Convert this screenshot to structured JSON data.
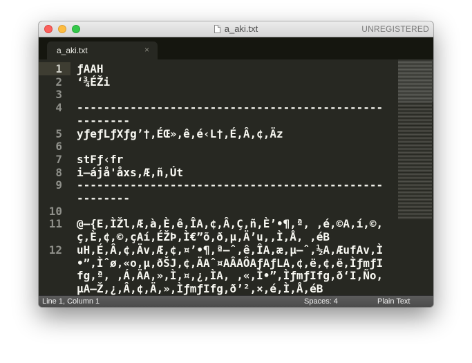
{
  "window": {
    "title": "a_aki.txt",
    "registration": "UNREGISTERED"
  },
  "tabs": [
    {
      "label": "a_aki.txt",
      "close": "×"
    }
  ],
  "editor": {
    "rows": [
      {
        "num": "1",
        "text": "ƒAAH"
      },
      {
        "num": "2",
        "text": "‘¾ÉŽi"
      },
      {
        "num": "3",
        "text": ""
      },
      {
        "num": "4",
        "text": "----------------------------------------------"
      },
      {
        "num": "",
        "text": "--------"
      },
      {
        "num": "5",
        "text": "yƒeƒLƒXƒg’†,ÉŒ»,ê,é‹L†,É,Â,¢,Äz"
      },
      {
        "num": "6",
        "text": ""
      },
      {
        "num": "7",
        "text": "stFƒ‹fr"
      },
      {
        "num": "8",
        "text": "i–ájå'åxs,Æ,ñ,Út"
      },
      {
        "num": "9",
        "text": "----------------------------------------------"
      },
      {
        "num": "",
        "text": "--------"
      },
      {
        "num": "10",
        "text": ""
      },
      {
        "num": "11",
        "text": "@—{E,ÌŽl,Æ,à,È,ê,ÎA,¢,Â,Ç,ñ,È’•¶,ª, ,é,©A,í,©,"
      },
      {
        "num": "",
        "text": "ç,È,¢,©,çAí,ÉŽÞ,Ì€”õ,ð,µ,Ä’u,,Ì,Å, ,éB"
      },
      {
        "num": "12",
        "text": "uH,É,Â,¢,Äv,Æ,¢,¤’•¶,ª—ˆ,ê,ÎA,æ,µ—ˆ,½A,ÆufAv,Ì"
      },
      {
        "num": "",
        "text": "•”,Ìˆø,«o,µ,ðŠJ,¢,ÄAˆ¤AÂAÔAƒAƒLA,¢,ë,¢,ë,ÌƒmƒI"
      },
      {
        "num": "",
        "text": "fg,ª, ,Á,ÄA,»,Ì,¤,¿,ÌA, ,«,Ì•”,ÌƒmƒIfg,ð‘I,Ño,"
      },
      {
        "num": "",
        "text": "µA–Ž,¿,Â,¢,Ä,»,ÌƒmƒIfg,ð’²,×,é,Ì,Å,éB"
      }
    ]
  },
  "statusbar": {
    "position": "Line 1, Column 1",
    "spaces": "Spaces: 4",
    "syntax": "Plain Text"
  },
  "colors": {
    "editor_bg": "#272822",
    "text": "#f8f8f2",
    "gutter_text": "#8f908a",
    "tabbar_bg": "#15160f"
  },
  "icons": [
    "close-window",
    "minimize-window",
    "zoom-window",
    "document-icon",
    "close-tab-icon"
  ]
}
